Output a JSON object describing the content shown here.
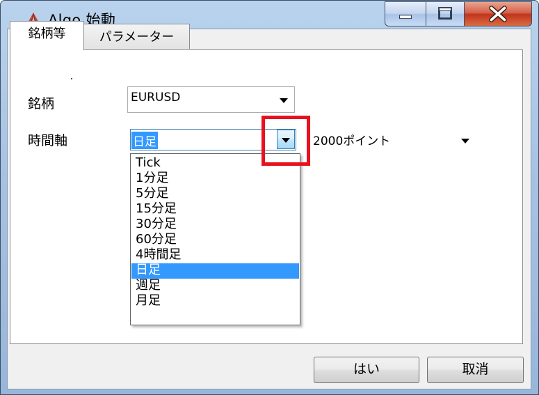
{
  "window": {
    "title": "Algo 始動",
    "controls": {
      "minimize": "minimize",
      "maximize": "maximize",
      "close": "close"
    }
  },
  "tabs": [
    {
      "label": "銘柄等",
      "active": true
    },
    {
      "label": "パラメーター",
      "active": false
    }
  ],
  "form": {
    "symbol_label": "銘柄",
    "symbol_value": "EURUSD",
    "timeframe_label": "時間軸",
    "timeframe_value": "日足",
    "points_value": "2000ポイント"
  },
  "timeframe_options": [
    "Tick",
    "1分足",
    "5分足",
    "15分足",
    "30分足",
    "60分足",
    "4時間足",
    "日足",
    "週足",
    "月足"
  ],
  "timeframe_selected_index": 7,
  "buttons": {
    "ok": "はい",
    "cancel": "取消"
  },
  "colors": {
    "highlight": "#e8121e",
    "selection": "#3399ff"
  }
}
